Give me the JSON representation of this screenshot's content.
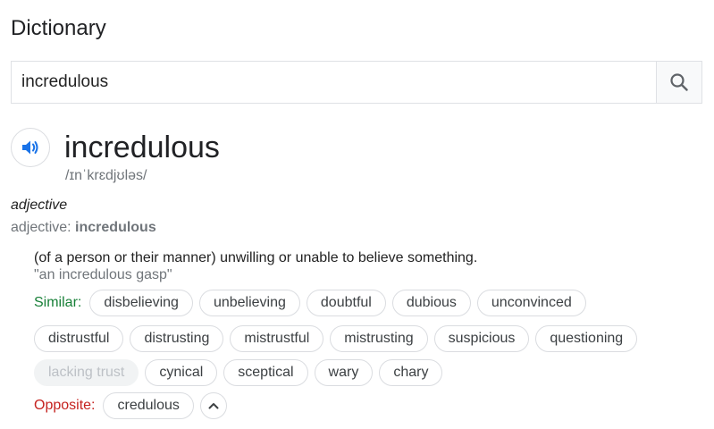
{
  "header": {
    "title": "Dictionary"
  },
  "search": {
    "value": "incredulous",
    "icon": "search-icon"
  },
  "entry": {
    "word": "incredulous",
    "phonetic": "/ɪnˈkrɛdjʊləs/",
    "audio_icon": "speaker-icon",
    "part_of_speech": "adjective",
    "pos_prefix": "adjective:",
    "pos_word": "incredulous",
    "definition": "(of a person or their manner) unwilling or unable to believe something.",
    "example": "\"an incredulous gasp\""
  },
  "similar": {
    "label": "Similar:",
    "row1": [
      "disbelieving",
      "unbelieving",
      "doubtful",
      "dubious",
      "unconvinced"
    ],
    "row2": [
      "distrustful",
      "distrusting",
      "mistrustful",
      "mistrusting",
      "suspicious",
      "questioning"
    ],
    "row3_disabled": "lacking trust",
    "row3": [
      "cynical",
      "sceptical",
      "wary",
      "chary"
    ]
  },
  "opposite": {
    "label": "Opposite:",
    "words": [
      "credulous"
    ],
    "collapse_icon": "chevron-up-icon"
  },
  "colors": {
    "similar_label": "#188038",
    "opposite_label": "#c5221f",
    "speaker": "#1a73e8"
  }
}
